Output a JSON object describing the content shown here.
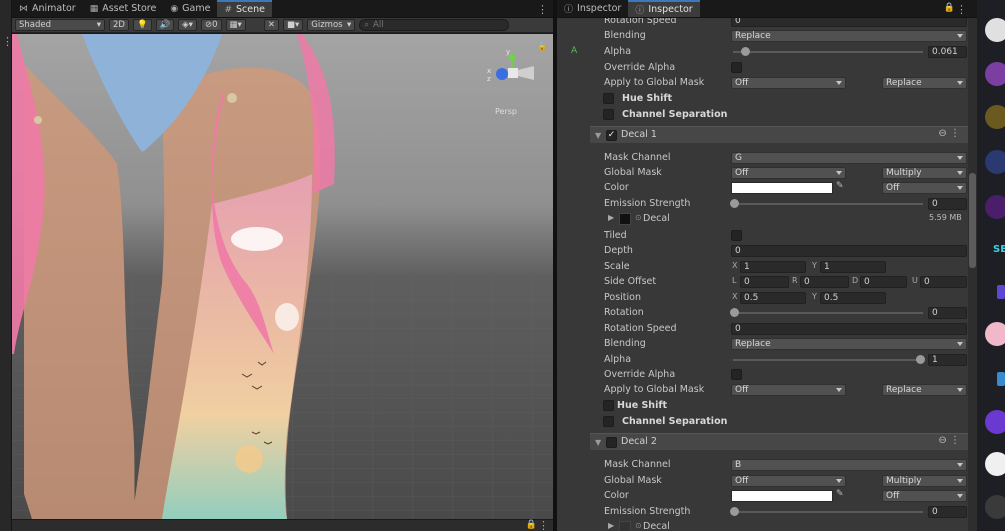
{
  "scene_tabs": [
    {
      "label": "Animator",
      "icon": "animator-icon"
    },
    {
      "label": "Asset Store",
      "icon": "store-icon"
    },
    {
      "label": "Game",
      "icon": "gamepad-icon"
    },
    {
      "label": "Scene",
      "icon": "grid-icon",
      "active": true
    }
  ],
  "toolbar": {
    "shading_mode": "Shaded",
    "mode_2d": "2D",
    "hidden_count": "0",
    "gizmos": "Gizmos",
    "search_placeholder": "All"
  },
  "gizmo": {
    "persp_label": "Persp",
    "axes": [
      "y",
      "x",
      "z"
    ]
  },
  "inspector_tabs": [
    {
      "label": "Inspector",
      "icon": "info-icon"
    },
    {
      "label": "Inspector",
      "icon": "info-icon",
      "active": true
    }
  ],
  "inspector": {
    "top": {
      "rotation_speed": {
        "label": "Rotation Speed",
        "value": "0"
      },
      "blending": {
        "label": "Blending",
        "value": "Replace"
      },
      "alpha_marker": "A",
      "alpha": {
        "label": "Alpha",
        "value": "0.061",
        "level": 0.061
      },
      "override_alpha": {
        "label": "Override Alpha"
      },
      "apply_global_mask": {
        "label": "Apply to Global Mask",
        "value": "Off",
        "value2": "Replace"
      },
      "hue_shift": "Hue Shift",
      "channel_separation": "Channel Separation"
    },
    "decal1": {
      "title": "Decal 1",
      "checked": true,
      "mask_channel": {
        "label": "Mask Channel",
        "value": "G"
      },
      "global_mask": {
        "label": "Global Mask",
        "value": "Off",
        "value2": "Multiply"
      },
      "color": {
        "label": "Color",
        "value2": "Off",
        "swatch": "#ffffff"
      },
      "emission_strength": {
        "label": "Emission Strength",
        "value": "0",
        "level": 0
      },
      "texture": {
        "name": "Decal",
        "size": "5.59 MB"
      },
      "tiled": {
        "label": "Tiled"
      },
      "depth": {
        "label": "Depth",
        "value": "0"
      },
      "scale": {
        "label": "Scale",
        "x_label": "X",
        "x": "1",
        "y_label": "Y",
        "y": "1"
      },
      "side_offset": {
        "label": "Side Offset",
        "l_label": "L",
        "l": "0",
        "r_label": "R",
        "r": "0",
        "d_label": "D",
        "d": "0",
        "u_label": "U",
        "u": "0"
      },
      "position": {
        "label": "Position",
        "x_label": "X",
        "x": "0.5",
        "y_label": "Y",
        "y": "0.5"
      },
      "rotation": {
        "label": "Rotation",
        "value": "0",
        "level": 0
      },
      "rotation_speed": {
        "label": "Rotation Speed",
        "value": "0"
      },
      "blending": {
        "label": "Blending",
        "value": "Replace"
      },
      "alpha": {
        "label": "Alpha",
        "value": "1",
        "level": 1
      },
      "override_alpha": {
        "label": "Override Alpha"
      },
      "apply_global_mask": {
        "label": "Apply to Global Mask",
        "value": "Off",
        "value2": "Replace"
      },
      "hue_shift": "Hue Shift",
      "channel_separation": "Channel Separation"
    },
    "decal2": {
      "title": "Decal 2",
      "checked": false,
      "mask_channel": {
        "label": "Mask Channel",
        "value": "B"
      },
      "global_mask": {
        "label": "Global Mask",
        "value": "Off",
        "value2": "Multiply"
      },
      "color": {
        "label": "Color",
        "value2": "Off",
        "swatch": "#ffffff"
      },
      "emission_strength": {
        "label": "Emission Strength",
        "value": "0",
        "level": 0
      },
      "texture": {
        "name": "Decal"
      }
    }
  },
  "sidebar_text": [
    "SE"
  ],
  "colors": {
    "accent": "#3a79bb",
    "panel": "#383838",
    "header": "#474747",
    "marker_green": "#4fbf5a"
  }
}
